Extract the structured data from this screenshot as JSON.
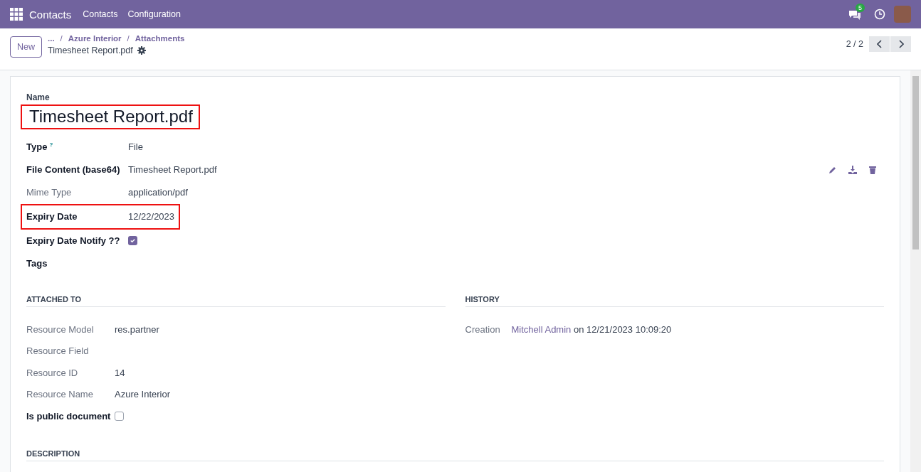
{
  "navbar": {
    "app_name": "Contacts",
    "menu": [
      "Contacts",
      "Configuration"
    ],
    "message_badge": "5"
  },
  "control_panel": {
    "new_button": "New",
    "breadcrumb_more": "...",
    "breadcrumbs": [
      {
        "separator": "/",
        "label": "Azure Interior"
      },
      {
        "separator": "/",
        "label": "Attachments"
      }
    ],
    "record_title": "Timesheet Report.pdf",
    "pager": "2 / 2"
  },
  "form": {
    "name_label": "Name",
    "name": "Timesheet Report.pdf",
    "name_highlighted": true,
    "fields": [
      {
        "kind": "text",
        "label": "Type",
        "help": "?",
        "value": "File",
        "required": true
      },
      {
        "kind": "file",
        "label": "File Content (base64)",
        "value": "Timesheet Report.pdf",
        "required": true
      },
      {
        "kind": "text",
        "label": "Mime Type",
        "value": "application/pdf",
        "required": false
      },
      {
        "kind": "text",
        "label": "Expiry Date",
        "value": "12/22/2023",
        "required": true,
        "highlighted": true
      },
      {
        "kind": "checkbox",
        "label": "Expiry Date Notify ??",
        "checked": true,
        "required": true
      },
      {
        "kind": "text",
        "label": "Tags",
        "required": true
      }
    ],
    "attached_to": {
      "title": "ATTACHED TO",
      "fields": [
        {
          "kind": "text",
          "label": "Resource Model",
          "value": "res.partner",
          "required": false
        },
        {
          "kind": "text",
          "label": "Resource Field",
          "required": false
        },
        {
          "kind": "text",
          "label": "Resource ID",
          "value": "14",
          "required": false
        },
        {
          "kind": "text",
          "label": "Resource Name",
          "value": "Azure Interior",
          "required": false
        },
        {
          "kind": "checkbox",
          "label": "Is public document",
          "checked": false,
          "required": true
        }
      ]
    },
    "history": {
      "title": "HISTORY",
      "creation_label": "Creation",
      "creation_user": "Mitchell Admin",
      "creation_rest": "on 12/21/2023 10:09:20"
    },
    "description": {
      "title": "DESCRIPTION"
    }
  }
}
